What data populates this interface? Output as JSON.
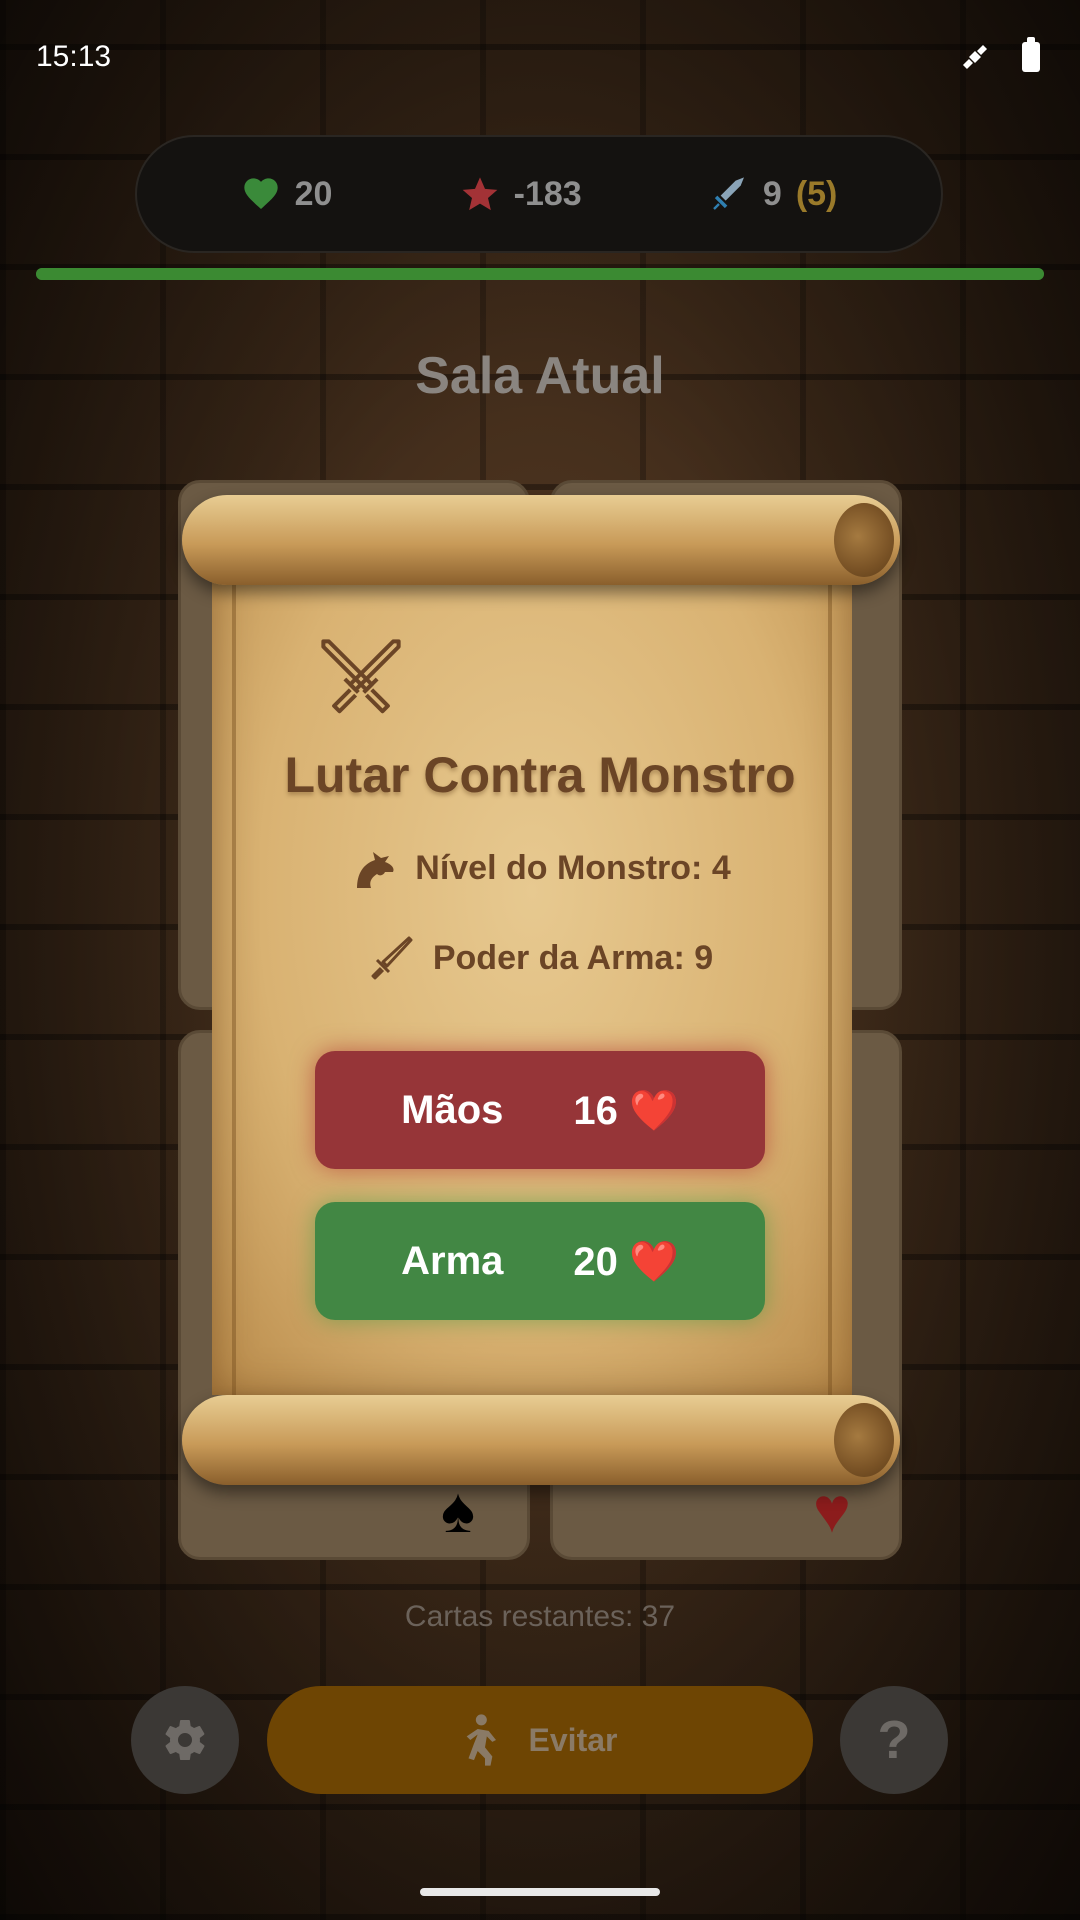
{
  "status_bar": {
    "time": "15:13",
    "icons": [
      "satellite-icon",
      "battery-icon"
    ]
  },
  "stats": {
    "health": "20",
    "score": "-183",
    "weapon_power": "9",
    "weapon_extra": "(5)",
    "health_fraction": 1.0
  },
  "room": {
    "title": "Sala Atual"
  },
  "cards": {
    "suits": [
      "♠",
      "♥"
    ]
  },
  "modal": {
    "title": "Lutar Contra Monstro",
    "monster_level": "Nível do Monstro: 4",
    "weapon_power": "Poder da Arma: 9",
    "hands_button": {
      "label": "Mãos",
      "value": "16",
      "heart": "❤️"
    },
    "weapon_button": {
      "label": "Arma",
      "value": "20",
      "heart": "❤️"
    }
  },
  "footer": {
    "cards_left": "Cartas restantes: 37",
    "avoid_label": "Evitar",
    "help_label": "?"
  },
  "colors": {
    "hands_button": "#963538",
    "weapon_button": "#428744",
    "avoid_button": "#6e4503",
    "health_bar": "#3b8a32"
  }
}
